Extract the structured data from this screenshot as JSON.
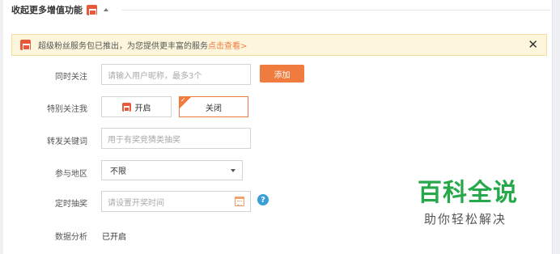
{
  "header": {
    "collapse_label": "收起更多增值功能"
  },
  "notice": {
    "text": "超级粉丝服务包已推出，为您提供更丰富的服务",
    "link_text": "点击查看>",
    "close_label": "✕"
  },
  "form": {
    "follow": {
      "label": "同时关注",
      "placeholder": "请输入用户昵称，最多3个",
      "button": "添加"
    },
    "special_follow": {
      "label": "特别关注我",
      "on_label": "开启",
      "off_label": "关闭",
      "selected": "关闭"
    },
    "keyword": {
      "label": "转发关键词",
      "placeholder": "用于有奖竞猜类抽奖"
    },
    "region": {
      "label": "参与地区",
      "value": "不限"
    },
    "timed_draw": {
      "label": "定时抽奖",
      "placeholder": "请设置开奖时间",
      "help": "?"
    },
    "analytics": {
      "label": "数据分析",
      "value": "已开启"
    }
  },
  "watermark": {
    "title": "百科全说",
    "subtitle": "助你轻松解决"
  },
  "colors": {
    "accent": "#f07b3f",
    "brand_green": "#27a84a",
    "help_blue": "#3a9fd8",
    "notice_bg": "#fdf6dc"
  }
}
